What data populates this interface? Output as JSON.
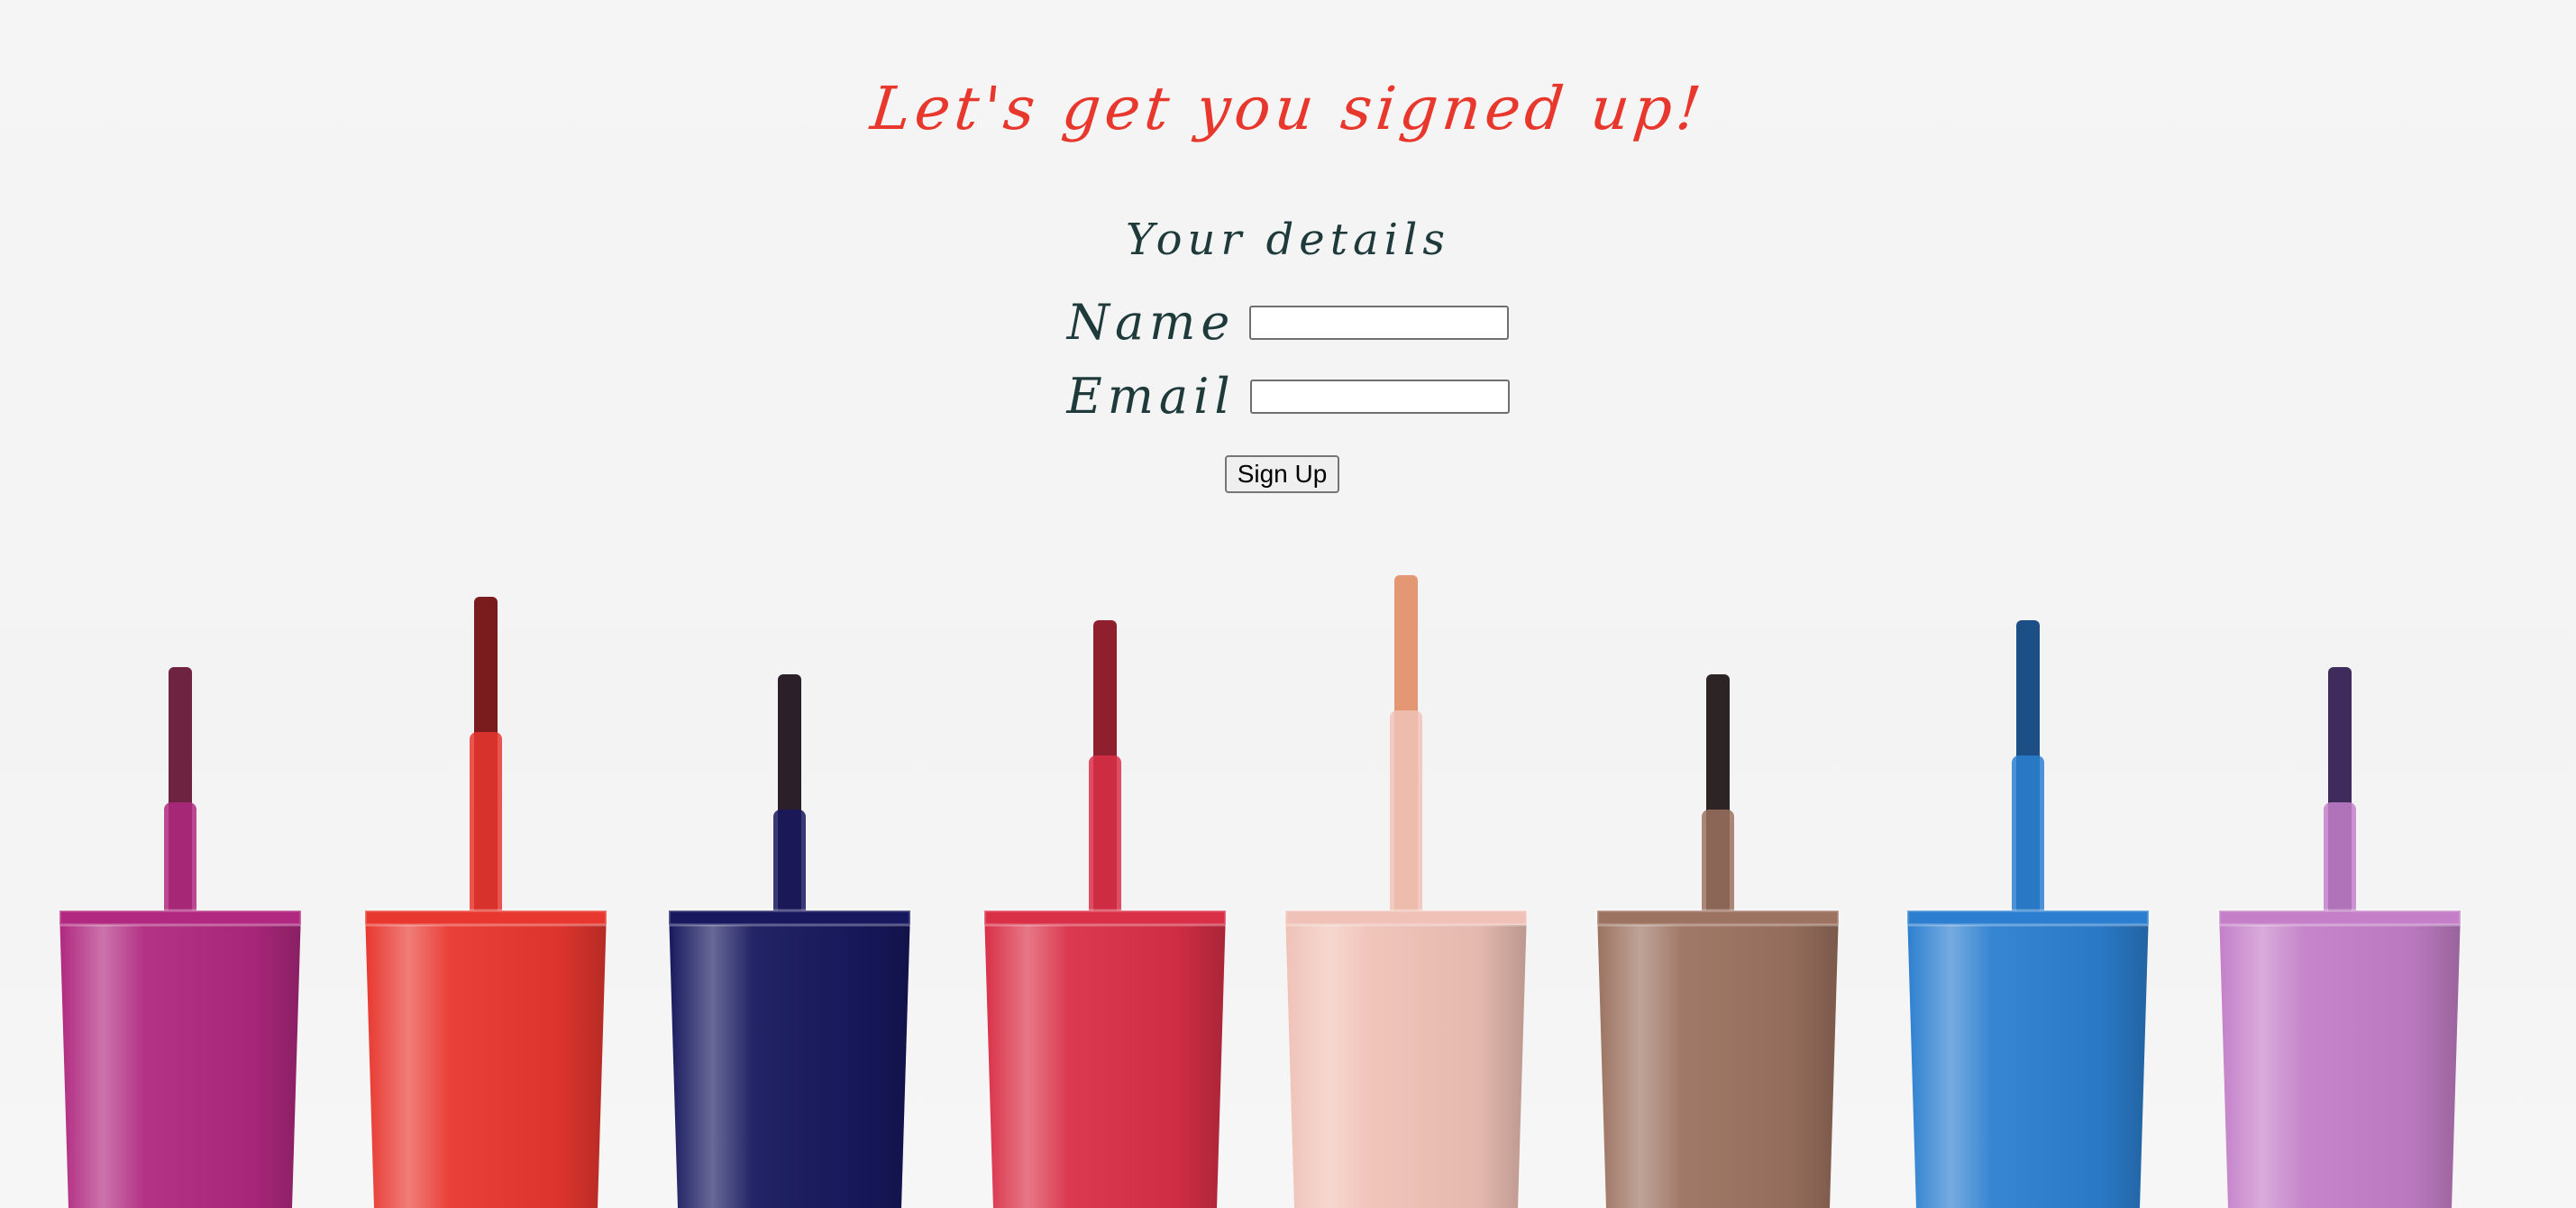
{
  "heading": "Let's get you signed up!",
  "form": {
    "section_title": "Your details",
    "name_label": "Name",
    "name_value": "",
    "email_label": "Email",
    "email_value": "",
    "submit_label": "Sign Up"
  },
  "background": {
    "polish_colors": [
      "#b0287f",
      "#e8372f",
      "#17185e",
      "#d92f47",
      "#f0c2b7",
      "#9c7260",
      "#2c7fd0",
      "#c47fc8"
    ],
    "brush_colors": [
      "#6e2340",
      "#7a1b1d",
      "#2b1f2a",
      "#8f1f2d",
      "#e39873",
      "#2d2425",
      "#1b4f86",
      "#3f2b5c"
    ]
  }
}
